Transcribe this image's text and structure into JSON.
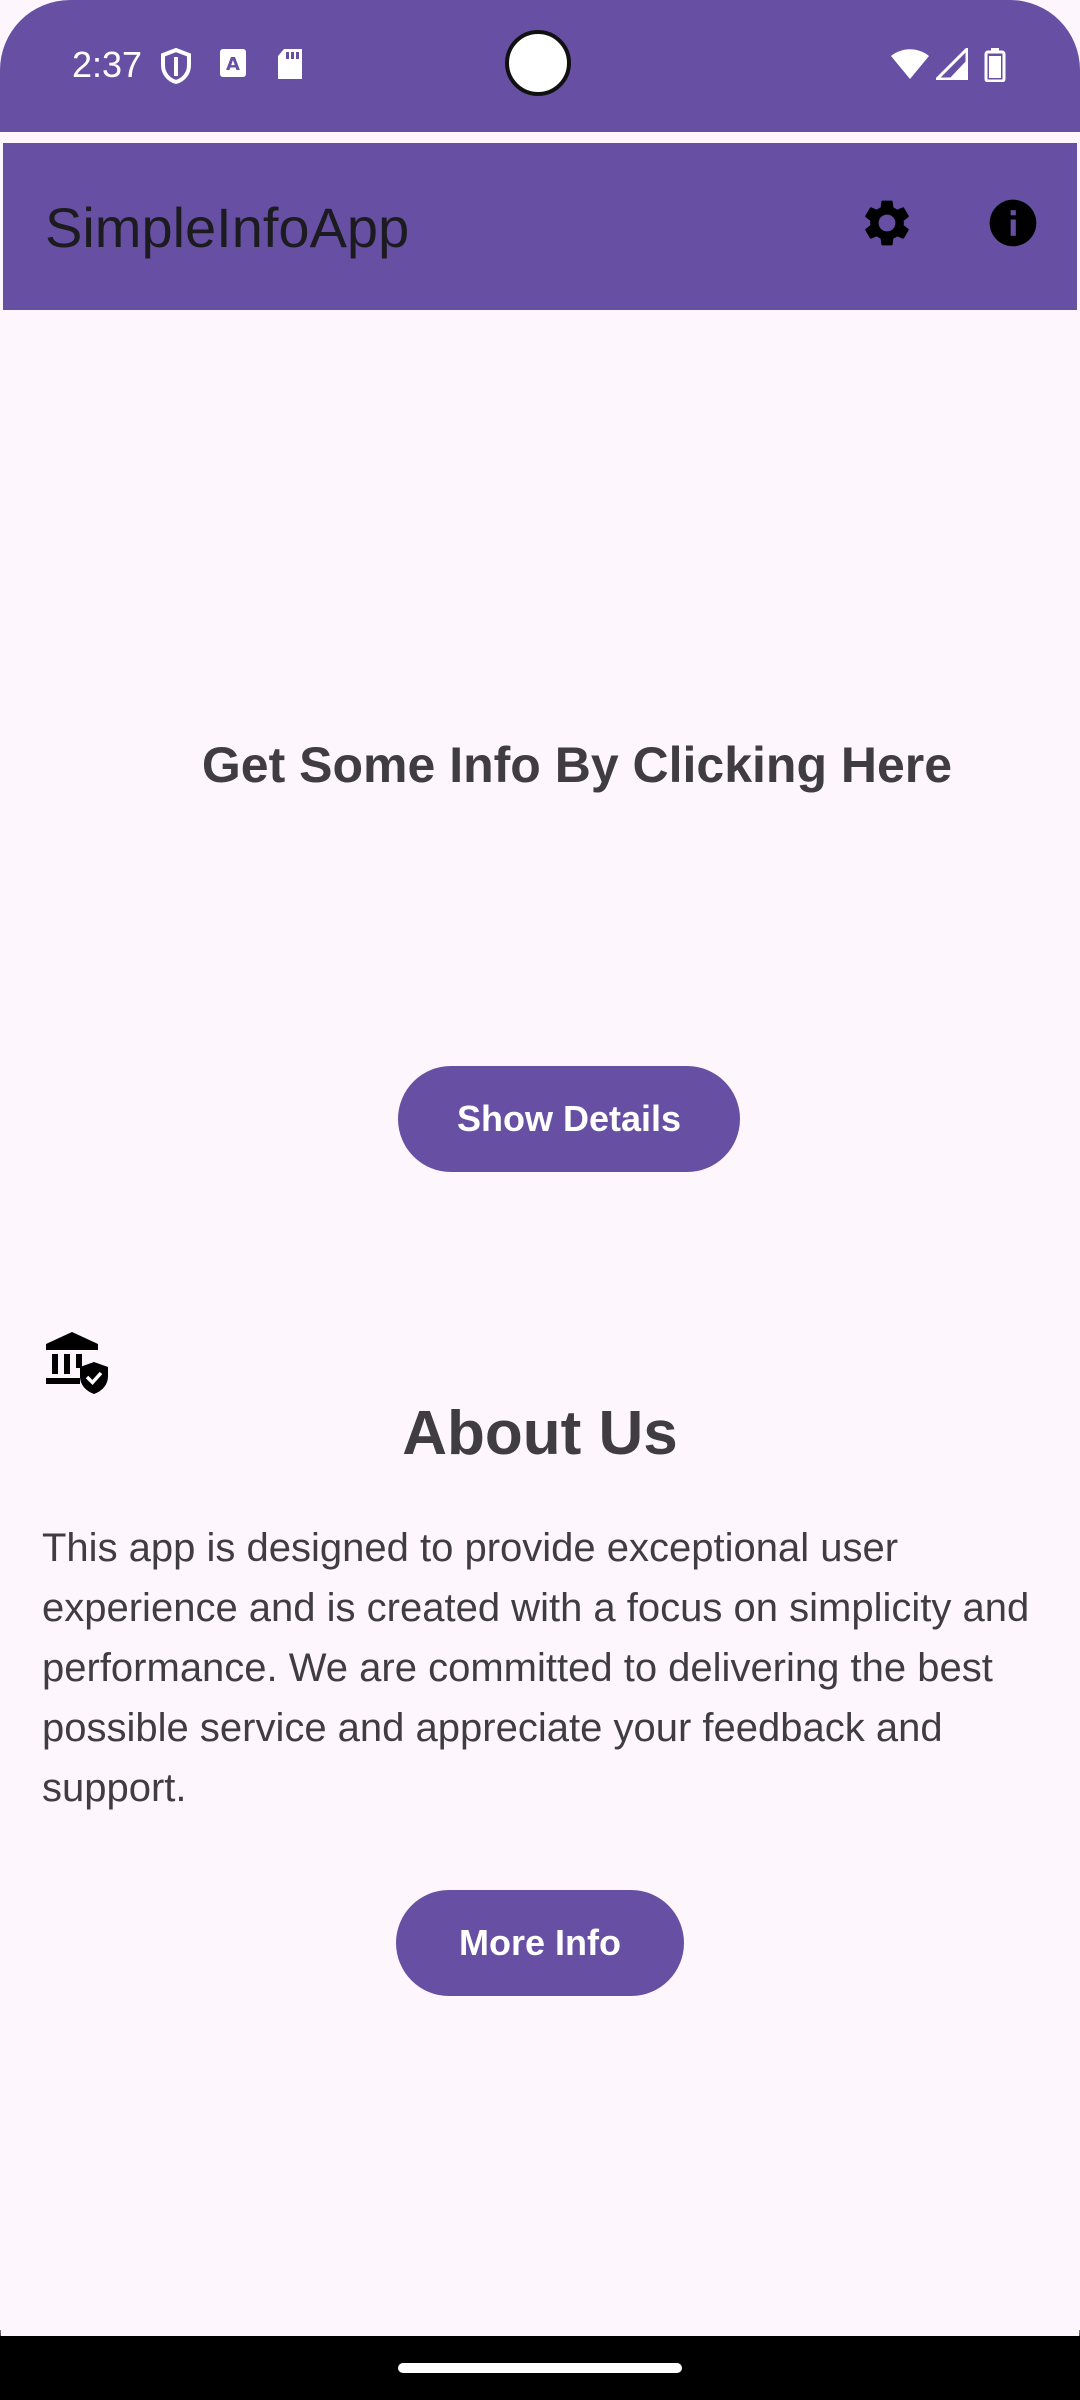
{
  "status_bar": {
    "time": "2:37",
    "icons": [
      "shield-icon",
      "font-a-icon",
      "sd-card-icon",
      "wifi-icon",
      "signal-icon",
      "battery-icon"
    ]
  },
  "app_bar": {
    "title": "SimpleInfoApp",
    "actions": [
      "gear-icon",
      "info-icon"
    ]
  },
  "main": {
    "headline": "Get Some Info By Clicking Here",
    "show_details_label": "Show Details"
  },
  "about": {
    "icon": "bank-shield-icon",
    "title": "About Us",
    "body": "This app is designed to provide exceptional user experience and is created with a focus on simplicity and performance. We are committed to delivering the best possible service and appreciate your feedback and support.",
    "more_info_label": "More Info"
  },
  "colors": {
    "primary": "#6750a4",
    "background": "#fdf6fc",
    "text": "#3f3d42",
    "on_primary": "#ffffff"
  }
}
